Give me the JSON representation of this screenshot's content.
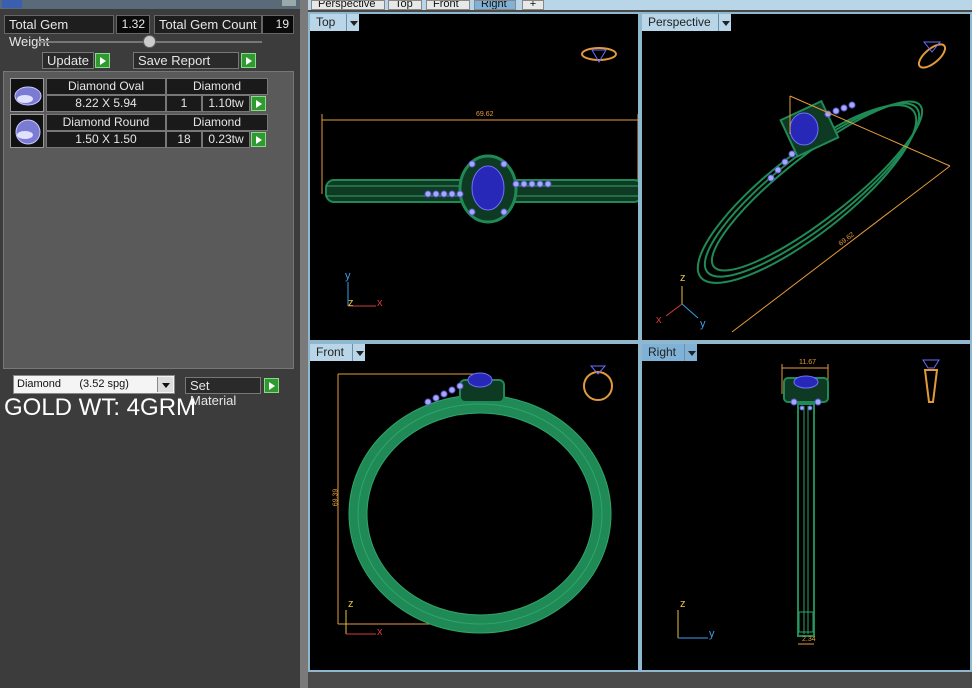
{
  "left_panel": {
    "total_gem_weight_label": "Total Gem Weight",
    "total_gem_weight_value": "1.32",
    "total_gem_count_label": "Total Gem Count",
    "total_gem_count_value": "19",
    "update_label": "Update",
    "save_report_label": "Save Report",
    "gems": [
      {
        "name": "Diamond Oval",
        "material": "Diamond",
        "size": "8.22 X 5.94",
        "count": "1",
        "weight": "1.10tw"
      },
      {
        "name": "Diamond Round",
        "material": "Diamond",
        "size": "1.50 X 1.50",
        "count": "18",
        "weight": "0.23tw"
      }
    ],
    "material_select": "Diamond      (3.52 spg)",
    "set_material_label": "Set Material",
    "gold_weight_text": "GOLD WT: 4GRM"
  },
  "tabs": [
    "Perspective",
    "Top",
    "Front",
    "Right",
    "+"
  ],
  "active_tab": "Right",
  "viewports": {
    "top": {
      "label": "Top",
      "dimension": "69.62",
      "axis_1": "y",
      "axis_2": "z",
      "axis_3": "x"
    },
    "perspective": {
      "label": "Perspective",
      "dimension": "69.62",
      "axis_1": "z",
      "axis_2": "x",
      "axis_3": "y"
    },
    "front": {
      "label": "Front",
      "dimension": "69.39",
      "axis_1": "z",
      "axis_2": "x"
    },
    "right": {
      "label": "Right",
      "dimension_top": "11.67",
      "dimension_bottom": "2.34",
      "axis_1": "z",
      "axis_2": "y"
    }
  },
  "colors": {
    "ring_green": "#1f8a55",
    "gem_blue": "#3a3ad8",
    "accent_pave": "#a7a7ff",
    "dimension_orange": "#e39a3a",
    "axis_red": "#d83a3a",
    "axis_blue": "#3aa0e8"
  }
}
